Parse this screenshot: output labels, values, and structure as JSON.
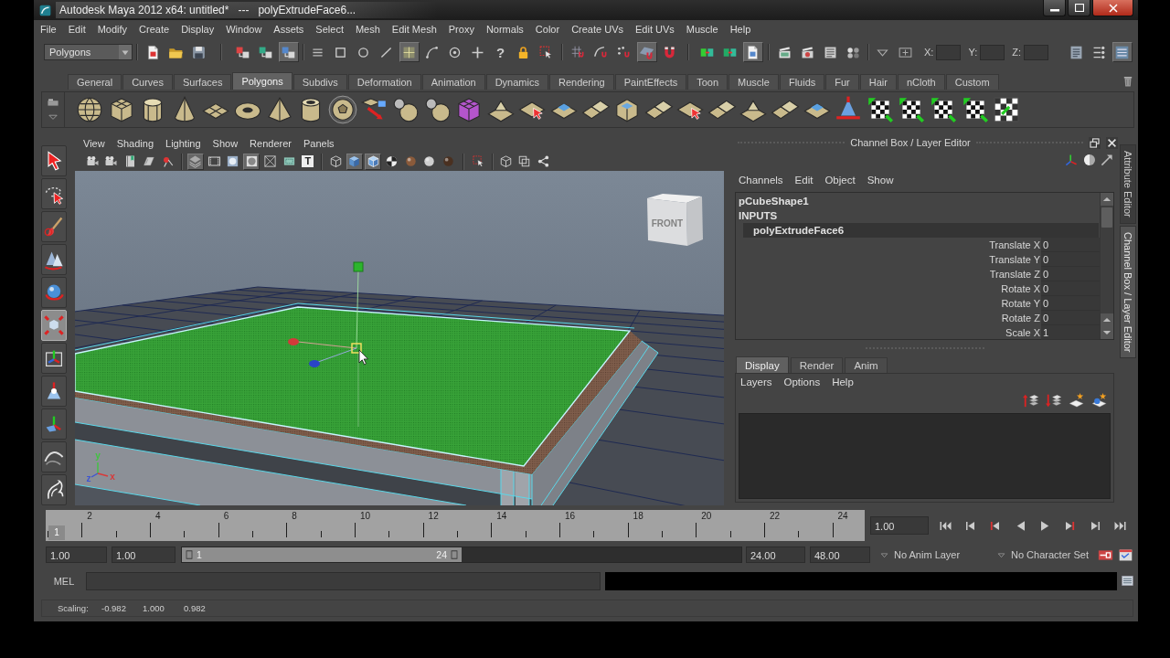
{
  "window": {
    "title": "Autodesk Maya 2012 x64: untitled*   ---   polyExtrudeFace6..."
  },
  "menu_bar": [
    "File",
    "Edit",
    "Modify",
    "Create",
    "Display",
    "Window",
    "Assets",
    "Select",
    "Mesh",
    "Edit Mesh",
    "Proxy",
    "Normals",
    "Color",
    "Create UVs",
    "Edit UVs",
    "Muscle",
    "Help"
  ],
  "status_line": {
    "menu_set": "Polygons",
    "buttons": [
      {
        "on": false
      },
      {
        "on": false
      },
      {
        "on": false
      },
      {
        "on": false
      },
      {
        "on": false
      },
      {
        "on": true
      },
      {
        "on": false
      },
      {
        "on": false
      },
      {
        "on": false
      },
      {
        "on": false
      },
      {
        "on": true
      },
      {
        "on": false
      },
      {
        "on": false
      },
      {
        "on": false
      },
      {
        "label": "?",
        "on": false
      },
      {
        "on": false
      },
      {
        "on": false
      },
      {
        "on": false
      },
      {
        "on": false
      },
      {
        "on": false
      },
      {
        "on": true
      },
      {
        "on": false
      },
      {
        "on": false
      },
      {
        "on": false
      },
      {
        "on": true
      },
      {
        "on": false
      },
      {
        "on": false
      },
      {
        "on": false
      },
      {
        "on": false
      },
      {
        "on": false
      },
      {
        "on": false
      }
    ],
    "coordinate_fields": [
      {
        "label": "X:"
      },
      {
        "label": "Y:"
      },
      {
        "label": "Z:"
      }
    ],
    "panel_buttons": [
      {
        "on": false
      },
      {
        "on": false
      },
      {
        "on": true
      }
    ]
  },
  "shelf": {
    "tabs": [
      {
        "label": "General",
        "selected": false
      },
      {
        "label": "Curves",
        "selected": false
      },
      {
        "label": "Surfaces",
        "selected": false
      },
      {
        "label": "Polygons",
        "selected": true
      },
      {
        "label": "Subdivs",
        "selected": false
      },
      {
        "label": "Deformation",
        "selected": false
      },
      {
        "label": "Animation",
        "selected": false
      },
      {
        "label": "Dynamics",
        "selected": false
      },
      {
        "label": "Rendering",
        "selected": false
      },
      {
        "label": "PaintEffects",
        "selected": false
      },
      {
        "label": "Toon",
        "selected": false
      },
      {
        "label": "Muscle",
        "selected": false
      },
      {
        "label": "Fluids",
        "selected": false
      },
      {
        "label": "Fur",
        "selected": false
      },
      {
        "label": "Hair",
        "selected": false
      },
      {
        "label": "nCloth",
        "selected": false
      },
      {
        "label": "Custom",
        "selected": false
      }
    ]
  },
  "toolbox": [
    {
      "selected": false
    },
    {
      "selected": false
    },
    {
      "selected": false
    },
    {
      "selected": false
    },
    {
      "selected": false
    },
    {
      "selected": true
    },
    {
      "selected": false
    },
    {
      "selected": false
    },
    {
      "selected": false
    },
    {
      "selected": false
    },
    {
      "selected": false
    }
  ],
  "viewport": {
    "menu": [
      "View",
      "Shading",
      "Lighting",
      "Show",
      "Renderer",
      "Panels"
    ],
    "toolbar": [
      {
        "on": false
      },
      {
        "on": false
      },
      {
        "on": false
      },
      {
        "on": false
      },
      {
        "on": false
      },
      {
        "on": true
      },
      {
        "on": false
      },
      {
        "on": false
      },
      {
        "on": true
      },
      {
        "on": false
      },
      {
        "on": false
      },
      {
        "label": "T",
        "on": false
      },
      {
        "on": false
      },
      {
        "on": true
      },
      {
        "on": true
      },
      {
        "on": false
      },
      {
        "on": false
      },
      {
        "on": false
      },
      {
        "on": false
      },
      {
        "on": false
      },
      {
        "on": false
      },
      {
        "on": false
      },
      {
        "on": false
      }
    ],
    "view_cube": {
      "label": "FRONT"
    },
    "axes": [
      {
        "label": "y",
        "color": "#3fc43f"
      },
      {
        "label": "z",
        "color": "#3c55d2"
      },
      {
        "label": "x",
        "color": "#d83a3a"
      }
    ]
  },
  "channel_box": {
    "title": "Channel Box / Layer Editor",
    "menu": [
      "Channels",
      "Edit",
      "Object",
      "Show"
    ],
    "shape": "pCubeShape1",
    "section": "INPUTS",
    "node": {
      "name": "polyExtrudeFace6",
      "selected": true
    },
    "attributes": [
      {
        "name": "Translate X",
        "value": "0"
      },
      {
        "name": "Translate Y",
        "value": "0"
      },
      {
        "name": "Translate Z",
        "value": "0"
      },
      {
        "name": "Rotate X",
        "value": "0"
      },
      {
        "name": "Rotate Y",
        "value": "0"
      },
      {
        "name": "Rotate Z",
        "value": "0"
      },
      {
        "name": "Scale X",
        "value": "1"
      }
    ]
  },
  "layer_editor": {
    "tabs": [
      {
        "label": "Display",
        "selected": true
      },
      {
        "label": "Render",
        "selected": false
      },
      {
        "label": "Anim",
        "selected": false
      }
    ],
    "menu": [
      "Layers",
      "Options",
      "Help"
    ]
  },
  "side_tabs": [
    {
      "label": "Attribute Editor",
      "selected": false
    },
    {
      "label": "Channel Box / Layer Editor",
      "selected": true
    }
  ],
  "time_slider": {
    "labels": [
      "2",
      "4",
      "6",
      "8",
      "10",
      "12",
      "14",
      "16",
      "18",
      "20",
      "22",
      "24"
    ],
    "current_frame": "1",
    "level": 0,
    "current_time": "1.00"
  },
  "range_slider": {
    "start_time": "1.00",
    "playback_start": "1.00",
    "range_start": "1",
    "range_end": "24",
    "level": 0.5,
    "playback_end": "24.00",
    "end_time": "48.00",
    "anim_layer": "No Anim Layer",
    "character_set": "No Character Set"
  },
  "command_line": {
    "language": "MEL"
  },
  "help_line": {
    "label": "Scaling:",
    "values": [
      "-0.982",
      "1.000",
      "0.982"
    ]
  }
}
